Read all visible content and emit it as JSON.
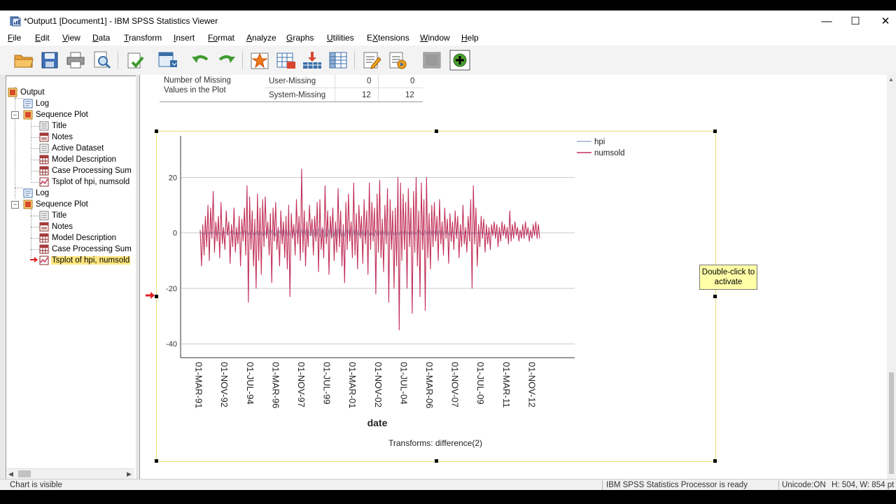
{
  "window": {
    "title": "*Output1 [Document1] - IBM SPSS Statistics Viewer",
    "controls": {
      "minimize": "—",
      "maximize": "☐",
      "close": "✕"
    }
  },
  "menu": [
    {
      "key": "F",
      "rest": "ile"
    },
    {
      "key": "E",
      "rest": "dit"
    },
    {
      "key": "V",
      "rest": "iew"
    },
    {
      "key": "D",
      "rest": "ata"
    },
    {
      "key": "T",
      "rest": "ransform"
    },
    {
      "key": "I",
      "rest": "nsert"
    },
    {
      "key": "Fo",
      "rest": "rmat"
    },
    {
      "key": "A",
      "rest": "nalyze"
    },
    {
      "key": "G",
      "rest": "raphs"
    },
    {
      "key": "U",
      "rest": "tilities"
    },
    {
      "key": "X",
      "rest": "tensions"
    },
    {
      "key": "W",
      "rest": "indow"
    },
    {
      "key": "H",
      "rest": "elp"
    }
  ],
  "toolbar_icons": [
    "open-folder-icon",
    "save-icon",
    "print-icon",
    "print-preview-icon",
    "export-icon",
    "recall-dialog-icon",
    "undo-icon",
    "redo-icon",
    "goto-case-icon",
    "goto-variable-icon",
    "insert-heading-icon",
    "insert-table-icon",
    "designate-window-icon",
    "insert-text-icon",
    "script-icon",
    "disabled-icon",
    "create-chart-icon"
  ],
  "outline": {
    "items": [
      {
        "label": "Output",
        "icon": "output-icon"
      },
      {
        "label": "Log",
        "icon": "log-icon"
      },
      {
        "label": "Sequence Plot",
        "icon": "procedure-icon"
      },
      {
        "label": "Title",
        "icon": "title-icon"
      },
      {
        "label": "Notes",
        "icon": "notes-icon"
      },
      {
        "label": "Active Dataset",
        "icon": "dataset-icon"
      },
      {
        "label": "Model Description",
        "icon": "table-icon"
      },
      {
        "label": "Case Processing Sum",
        "icon": "table-icon"
      },
      {
        "label": "Tsplot of hpi, numsold",
        "icon": "chart-icon"
      },
      {
        "label": "Log",
        "icon": "log-icon"
      },
      {
        "label": "Sequence Plot",
        "icon": "procedure-icon"
      },
      {
        "label": "Title",
        "icon": "title-icon"
      },
      {
        "label": "Notes",
        "icon": "notes-icon"
      },
      {
        "label": "Model Description",
        "icon": "table-icon"
      },
      {
        "label": "Case Processing Sum",
        "icon": "table-icon"
      },
      {
        "label": "Tsplot of hpi, numsold",
        "icon": "chart-icon",
        "selected": true
      }
    ]
  },
  "missing_table": {
    "row_header_line1": "Number of Missing",
    "row_header_line2": "Values in the Plot",
    "rows": [
      {
        "label": "User-Missing",
        "v1": "0",
        "v2": "0"
      },
      {
        "label": "System-Missing",
        "v1": "12",
        "v2": "12"
      }
    ]
  },
  "chart_data": {
    "type": "line",
    "title": "",
    "xlabel": "date",
    "ylabel": "",
    "footnote": "Transforms: difference(2)",
    "ylim": [
      -45,
      35
    ],
    "yticks": [
      20,
      0,
      -20,
      -40
    ],
    "x_tick_labels": [
      "01-MAR-91",
      "01-NOV-92",
      "01-JUL-94",
      "01-MAR-96",
      "01-NOV-97",
      "01-JUL-99",
      "01-MAR-01",
      "01-NOV-02",
      "01-JUL-04",
      "01-MAR-06",
      "01-NOV-07",
      "01-JUL-09",
      "01-MAR-11",
      "01-NOV-12"
    ],
    "x_start": "1991-01",
    "x_interval": "month",
    "grid": true,
    "legend_position": "top-right",
    "series": [
      {
        "name": "hpi",
        "color": "#9fb4cc",
        "values": [
          0.3,
          -0.2,
          0.4,
          -0.5,
          0.6,
          -0.3,
          0.2,
          -0.4,
          0.5,
          -0.6,
          0.3,
          -0.2,
          0.7,
          -0.5,
          0.4,
          -0.3,
          0.2,
          -0.6,
          0.5,
          -0.4,
          0.3,
          -0.2,
          0.6,
          -0.5,
          0.4,
          -0.3,
          0.8,
          -0.6,
          0.5,
          -0.4,
          0.3,
          -0.7,
          0.6,
          -0.5,
          0.4,
          -0.3,
          0.9,
          -0.8,
          0.7,
          -0.6,
          0.5,
          -0.9,
          0.8,
          -0.7,
          0.6,
          -0.5,
          1.0,
          -0.9,
          0.8,
          -0.7,
          0.6,
          -1.0,
          0.9,
          -0.8,
          0.7,
          -0.6,
          1.1,
          -1.0,
          0.9,
          -0.8,
          0.7,
          -1.1,
          1.0,
          -0.9,
          0.8,
          -0.7,
          1.2,
          -1.1,
          1.0,
          -0.9,
          0.8,
          -1.2,
          1.1,
          -1.0,
          0.9,
          -0.8,
          1.3,
          -1.2,
          1.1,
          -1.0,
          0.9,
          -1.3,
          1.2,
          -1.1,
          1.0,
          -0.9,
          1.4,
          -1.3,
          1.2,
          -1.1,
          1.0,
          -1.4,
          1.3,
          -1.2,
          1.1,
          -1.0,
          1.5,
          -1.4,
          1.3,
          -1.2,
          1.1,
          -1.5,
          1.4,
          -1.3,
          1.2,
          -1.1,
          1.6,
          -1.5,
          1.4,
          -1.3,
          1.2,
          -1.6,
          1.5,
          -1.4,
          1.3,
          -1.2,
          1.4,
          -1.3,
          1.2,
          -1.1,
          1.0,
          -1.4,
          1.3,
          -1.2,
          1.1,
          -1.0,
          1.2,
          -1.1,
          1.0,
          -0.9,
          0.8,
          -1.2,
          1.1,
          -1.0,
          0.9,
          -0.8,
          1.0,
          -0.9,
          0.8,
          -0.7,
          0.6,
          -1.0,
          0.9,
          -0.8,
          0.7,
          -0.6,
          0.9,
          -0.8,
          0.7,
          -0.6,
          0.5,
          -0.9,
          0.8,
          -0.7,
          0.6,
          -0.5,
          0.8,
          -0.7,
          0.6,
          -0.5,
          0.4,
          -0.8,
          0.7,
          -0.6,
          0.5,
          -0.4,
          0.7,
          -0.6,
          0.5,
          -0.4,
          0.3,
          -0.7,
          0.6,
          -0.5,
          0.4,
          -0.3,
          0.9,
          -0.8,
          0.7,
          -0.6,
          0.5,
          -0.9,
          0.8,
          -0.7,
          0.6,
          -0.5,
          1.0,
          -0.9,
          0.8,
          -0.7,
          0.6,
          -1.0,
          0.9,
          -0.8,
          0.7,
          -0.6,
          0.8,
          -0.7,
          0.6,
          -0.5,
          0.4,
          -0.8,
          0.7,
          -0.6,
          0.5,
          -0.4,
          0.6,
          -0.5,
          0.4,
          -0.3,
          0.2,
          -0.6,
          0.5,
          -0.4,
          0.3,
          -0.2,
          0.5,
          -0.4,
          0.3,
          -0.2,
          0.1,
          -0.5,
          0.4,
          -0.3,
          0.2,
          -0.1,
          0.6,
          -0.5,
          0.4,
          -0.3,
          0.2,
          -0.6,
          0.5,
          -0.4,
          0.3,
          -0.2,
          0.5,
          -0.4,
          0.3,
          -0.2,
          0.1,
          -0.5,
          0.4,
          -0.3,
          0.2,
          -0.1,
          0.4,
          -0.3,
          0.2,
          -0.1,
          0.1,
          -0.4,
          0.3,
          -0.2,
          0.1,
          -0.1,
          0.3,
          -0.2,
          0.2,
          -0.1,
          0.1,
          -0.3,
          0.2,
          -0.2,
          0.1,
          -0.1,
          0.2,
          -0.2,
          0.1,
          -0.1,
          0.1,
          -0.2,
          0.1,
          -0.1,
          0.1,
          -0.1
        ]
      },
      {
        "name": "numsold",
        "color": "#c2305a",
        "values": [
          1,
          -12,
          3,
          -8,
          6,
          -5,
          10,
          -10,
          9,
          -2,
          15,
          -7,
          4,
          -3,
          6,
          -9,
          11,
          -4,
          2,
          -6,
          8,
          -1,
          4,
          -11,
          3,
          -5,
          9,
          -7,
          2,
          -4,
          6,
          -12,
          5,
          -3,
          9,
          -8,
          17,
          -25,
          13,
          -6,
          8,
          -12,
          5,
          -20,
          14,
          -10,
          9,
          -15,
          12,
          -5,
          13,
          -2,
          4,
          -8,
          7,
          -18,
          9,
          -3,
          11,
          -6,
          2,
          -12,
          8,
          -4,
          4,
          -9,
          6,
          -13,
          10,
          -23,
          7,
          -2,
          3,
          -8,
          12,
          -4,
          6,
          -10,
          23,
          -7,
          8,
          -12,
          4,
          -5,
          10,
          -1,
          5,
          -8,
          6,
          -3,
          11,
          -14,
          12,
          -6,
          2,
          -9,
          17,
          -4,
          8,
          -15,
          6,
          -2,
          9,
          -10,
          4,
          -7,
          16,
          -5,
          8,
          -12,
          3,
          -18,
          11,
          -6,
          14,
          -3,
          4,
          -9,
          18,
          -8,
          7,
          -13,
          10,
          -2,
          6,
          -11,
          12,
          -4,
          8,
          -15,
          18,
          -6,
          11,
          -3,
          9,
          -22,
          14,
          -7,
          19,
          -9,
          5,
          -14,
          10,
          -4,
          16,
          -25,
          12,
          -6,
          8,
          -20,
          9,
          -12,
          20,
          -35,
          18,
          -10,
          14,
          -6,
          11,
          -20,
          16,
          -5,
          9,
          -29,
          15,
          -7,
          20,
          -12,
          8,
          -23,
          18,
          -6,
          12,
          -28,
          20,
          -9,
          7,
          -13,
          10,
          -5,
          11,
          -3,
          6,
          -10,
          12,
          -4,
          4,
          -8,
          9,
          -2,
          5,
          -11,
          7,
          -3,
          4,
          -6,
          8,
          -2,
          6,
          -9,
          3,
          -5,
          10,
          -4,
          2,
          -7,
          6,
          -3,
          12,
          -20,
          17,
          -4,
          9,
          -12,
          3,
          -5,
          6,
          -2,
          5,
          -7,
          3,
          -4,
          2,
          -6,
          3,
          -1,
          4,
          -2,
          3,
          -5,
          2,
          -3,
          4,
          -1,
          3,
          -2,
          2,
          -4,
          8,
          -3,
          3,
          -2,
          4,
          -1,
          2,
          -3,
          1,
          -2,
          3,
          -2,
          4,
          -1,
          2,
          -3,
          1,
          -2,
          3,
          -1,
          4,
          -2,
          3,
          -2
        ]
      }
    ]
  },
  "tooltip": {
    "line1": "Double-click to",
    "line2": "activate"
  },
  "status": {
    "left": "Chart is visible",
    "processor": "IBM SPSS Statistics Processor is ready",
    "unicode": "Unicode:ON",
    "size": "H: 504, W: 854 pt"
  }
}
